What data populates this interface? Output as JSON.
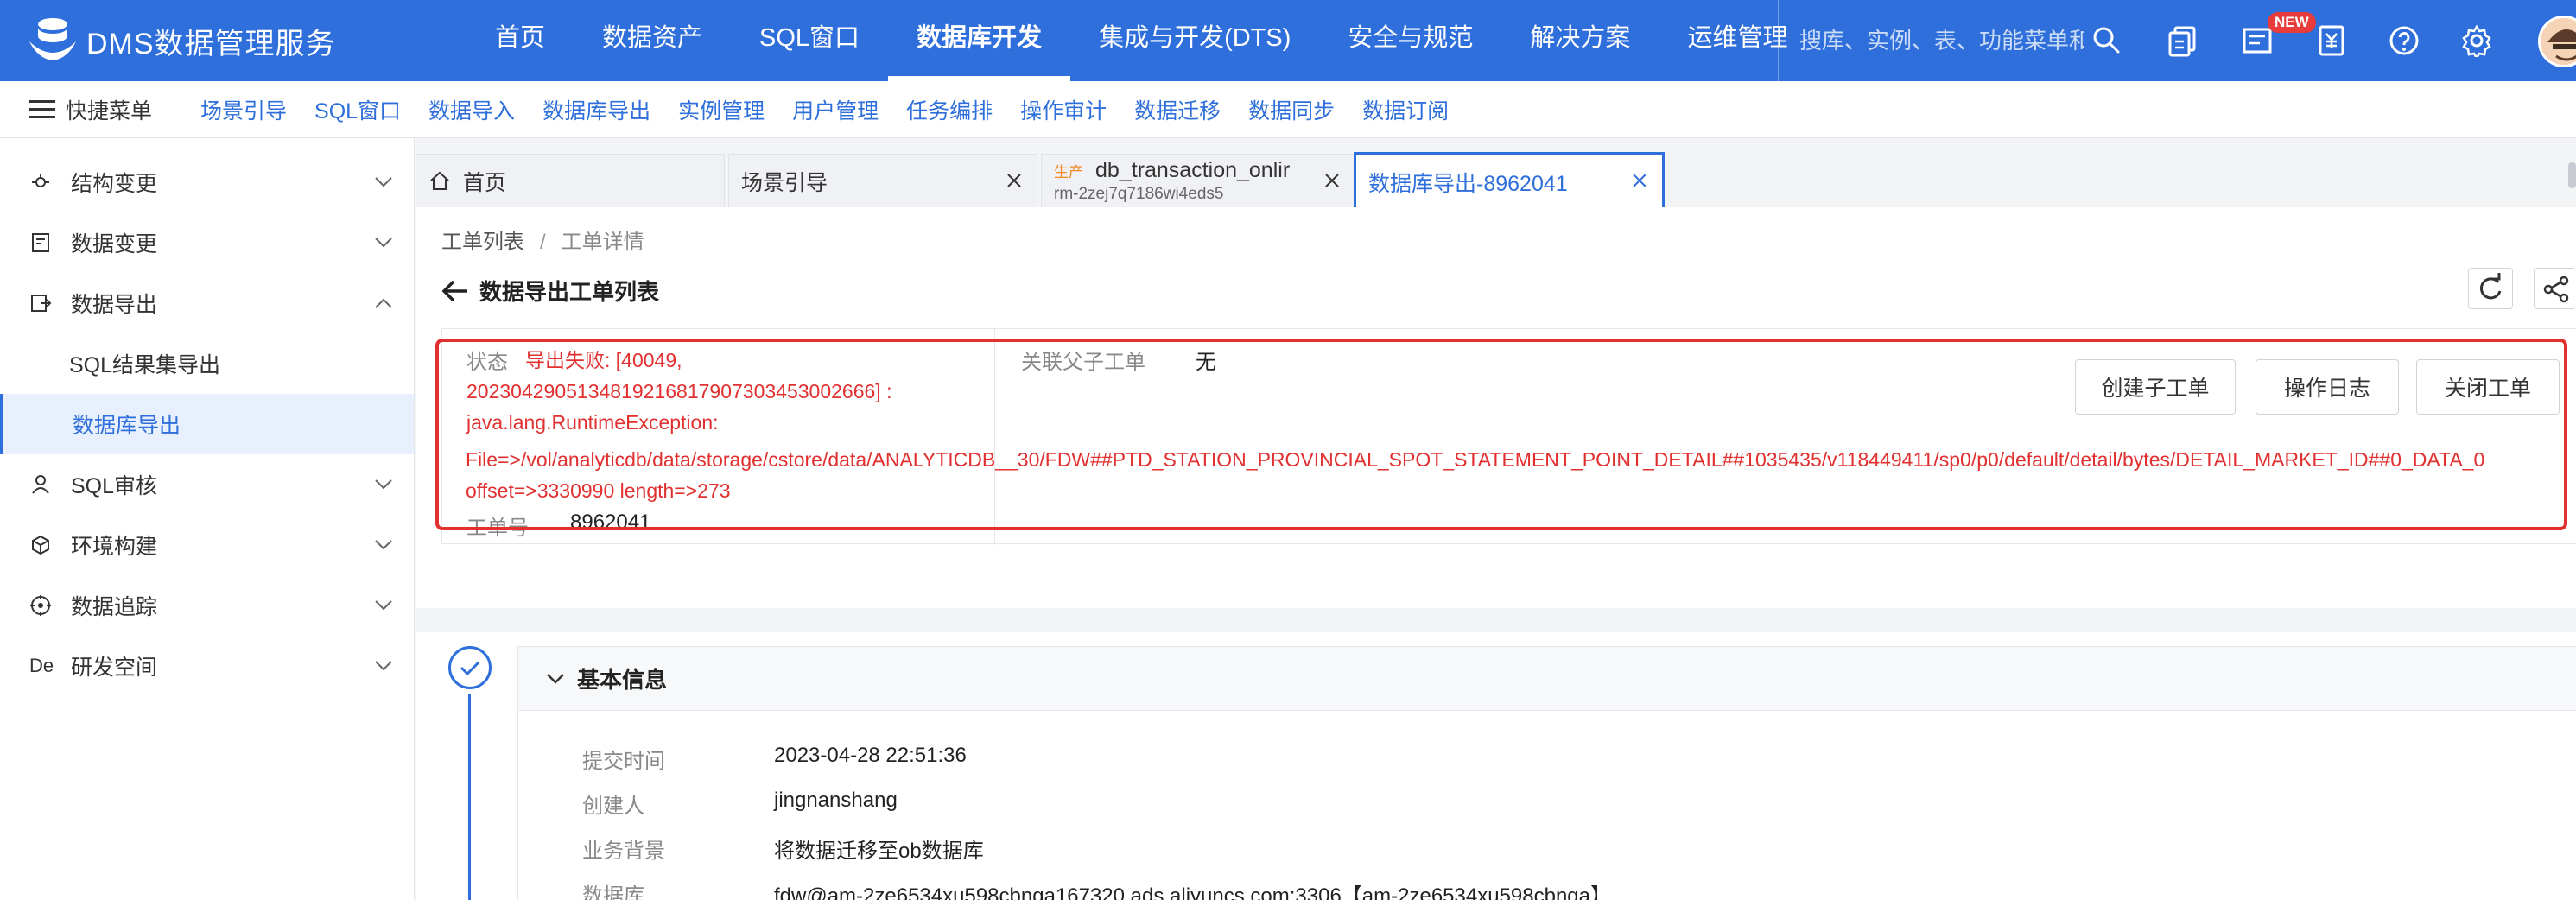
{
  "app": {
    "title": "DMS数据管理服务"
  },
  "nav": {
    "items": [
      "首页",
      "数据资产",
      "SQL窗口",
      "数据库开发",
      "集成与开发(DTS)",
      "安全与规范",
      "解决方案",
      "运维管理"
    ],
    "active": "数据库开发"
  },
  "search": {
    "placeholder": "搜库、实例、表、功能菜单和..."
  },
  "badge": {
    "new": "NEW"
  },
  "quickbar": {
    "toggle_label": "快捷菜单",
    "items": [
      "场景引导",
      "SQL窗口",
      "数据导入",
      "数据库导出",
      "实例管理",
      "用户管理",
      "任务编排",
      "操作审计",
      "数据迁移",
      "数据同步",
      "数据订阅"
    ]
  },
  "sidebar": {
    "items": [
      {
        "label": "结构变更",
        "icon": "structure-icon"
      },
      {
        "label": "数据变更",
        "icon": "data-change-icon"
      },
      {
        "label": "数据导出",
        "icon": "export-icon"
      },
      {
        "label": "SQL审核",
        "icon": "user-audit-icon"
      },
      {
        "label": "环境构建",
        "icon": "cube-icon"
      },
      {
        "label": "数据追踪",
        "icon": "target-icon"
      },
      {
        "label": "研发空间",
        "icon": "de-icon"
      }
    ],
    "sub_items": [
      "SQL结果集导出",
      "数据库导出"
    ],
    "de_text": "De"
  },
  "tabs": [
    {
      "label": "首页"
    },
    {
      "label": "场景引导"
    },
    {
      "tag": "生产",
      "label": "db_transaction_onlir",
      "sublabel": "rm-2zej7q7186wi4eds5"
    },
    {
      "label": "数据库导出-8962041"
    }
  ],
  "breadcrumb": {
    "root": "工单列表",
    "sep": "/",
    "current": "工单详情"
  },
  "page": {
    "title": "数据导出工单列表"
  },
  "ticket": {
    "status_label": "状态",
    "status_lines": [
      "导出失败: [40049,",
      "2023042905134819216817907303453002666] :",
      "java.lang.RuntimeException:",
      "File=>/vol/analyticdb/data/storage/cstore/data/ANALYTICDB__30/FDW##PTD_STATION_PROVINCIAL_SPOT_STATEMENT_POINT_DETAIL##1035435/v118449411/sp0/p0/default/detail/bytes/DETAIL_MARKET_ID##0_DATA_0",
      "offset=>3330990 length=>273"
    ],
    "parent_label": "关联父子工单",
    "parent_value": "无",
    "number_label": "工单号",
    "number_value": "8962041",
    "actions": [
      "创建子工单",
      "操作日志",
      "关闭工单"
    ]
  },
  "basic_info": {
    "title": "基本信息",
    "rows": [
      {
        "key": "提交时间",
        "value": "2023-04-28 22:51:36"
      },
      {
        "key": "创建人",
        "value": "jingnanshang"
      },
      {
        "key": "业务背景",
        "value": "将数据迁移至ob数据库"
      },
      {
        "key": "数据库",
        "value": "fdw@am-2ze6534xu598cbnga167320.ads.aliyuncs.com:3306【am-2ze6534xu598cbnga】"
      }
    ]
  },
  "colors": {
    "brand": "#2f6fdb",
    "error": "#e22f2f",
    "highlight": "#e03030",
    "prod_tag": "#f08a24"
  }
}
